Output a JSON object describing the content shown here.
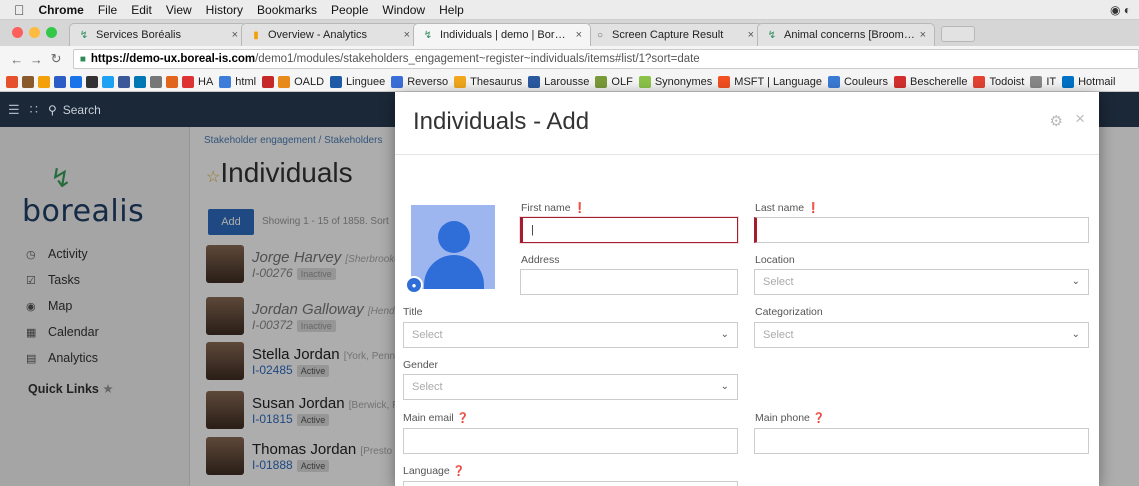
{
  "menubar": {
    "items": [
      "Chrome",
      "File",
      "Edit",
      "View",
      "History",
      "Bookmarks",
      "People",
      "Window",
      "Help"
    ]
  },
  "tabs": [
    {
      "label": "Services Boréalis"
    },
    {
      "label": "Overview - Analytics"
    },
    {
      "label": "Individuals | demo | Boréalis"
    },
    {
      "label": "Screen Capture Result"
    },
    {
      "label": "Animal concerns [Broome (Cit"
    }
  ],
  "address": {
    "host": "https://demo-ux.boreal-is.com",
    "path": "/demo1/modules/stakeholders_engagement~register~individuals/items#list/1?sort=date"
  },
  "bookmarks": [
    {
      "label": "HA",
      "color": "#d33"
    },
    {
      "label": "html",
      "color": "#3b7dd8"
    },
    {
      "label": "OALD",
      "color": "#e88a1a"
    },
    {
      "label": "Linguee",
      "color": "#1e5aa8"
    },
    {
      "label": "Reverso",
      "color": "#3b6fd8"
    },
    {
      "label": "Thesaurus",
      "color": "#f2a81d"
    },
    {
      "label": "Larousse",
      "color": "#2b5aa0"
    },
    {
      "label": "OLF",
      "color": "#7a9b3a"
    },
    {
      "label": "Synonymes",
      "color": "#8bc34a"
    },
    {
      "label": "MSFT | Language",
      "color": "#f25022"
    },
    {
      "label": "Couleurs",
      "color": "#3a7bd5"
    },
    {
      "label": "Bescherelle",
      "color": "#d32f2f"
    },
    {
      "label": "Todoist",
      "color": "#e44332"
    },
    {
      "label": "IT",
      "color": "#888888"
    },
    {
      "label": "Hotmail",
      "color": "#0072c6"
    }
  ],
  "appheader": {
    "search_label": "Search"
  },
  "sidebar": {
    "logo_text": "borealis",
    "items": [
      "Activity",
      "Tasks",
      "Map",
      "Calendar",
      "Analytics"
    ],
    "quick_links": "Quick Links"
  },
  "content": {
    "breadcrumb": "Stakeholder engagement  /  Stakeholders",
    "title": "Individuals",
    "add_label": "Add",
    "showing": "Showing 1 - 15 of 1858. Sort",
    "people": [
      {
        "name": "Jorge Harvey",
        "loc": "[Sherbrooke",
        "id": "I-00276",
        "status": "Inactive"
      },
      {
        "name": "Jordan Galloway",
        "loc": "[Hend",
        "id": "I-00372",
        "status": "Inactive"
      },
      {
        "name": "Stella Jordan",
        "loc": "[York, Penn",
        "id": "I-02485",
        "status": "Active"
      },
      {
        "name": "Susan Jordan",
        "loc": "[Berwick, P",
        "id": "I-01815",
        "status": "Active"
      },
      {
        "name": "Thomas Jordan",
        "loc": "[Presto",
        "id": "I-01888",
        "status": "Active"
      }
    ]
  },
  "modal": {
    "title": "Individuals - Add",
    "first_name": {
      "label": "First name",
      "value": "|"
    },
    "last_name": {
      "label": "Last name",
      "value": ""
    },
    "address": {
      "label": "Address",
      "value": ""
    },
    "location": {
      "label": "Location",
      "placeholder": "Select"
    },
    "title_field": {
      "label": "Title",
      "placeholder": "Select"
    },
    "categorization": {
      "label": "Categorization",
      "placeholder": "Select"
    },
    "gender": {
      "label": "Gender",
      "placeholder": "Select"
    },
    "main_email": {
      "label": "Main email",
      "value": ""
    },
    "main_phone": {
      "label": "Main phone",
      "value": ""
    },
    "language": {
      "label": "Language"
    }
  }
}
